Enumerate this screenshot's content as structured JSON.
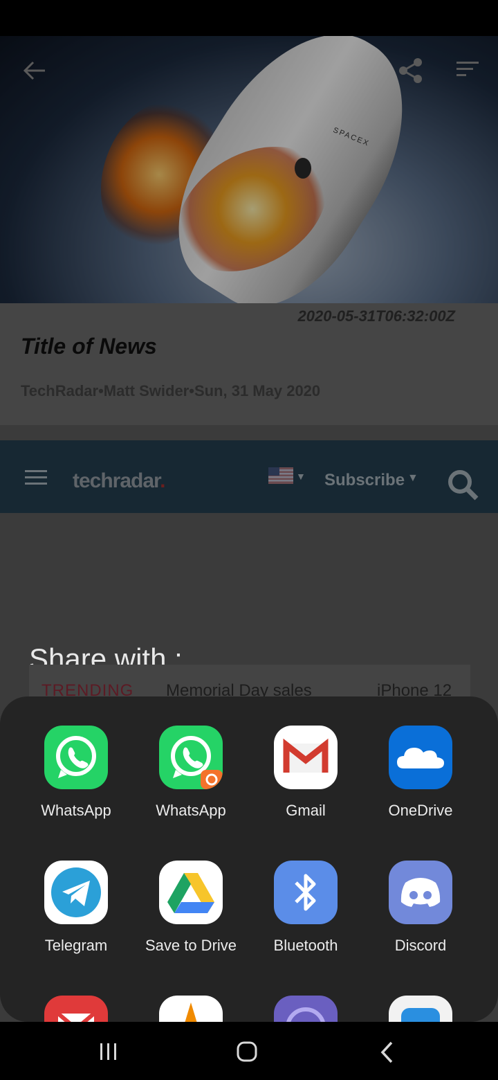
{
  "article": {
    "date": "2020-05-31T06:32:00Z",
    "title": "Title of News",
    "meta": "TechRadar•Matt Swider•Sun, 31 May 2020",
    "image_brand_text": "SPACEX"
  },
  "website": {
    "logo": "techradar",
    "subscribe": "Subscribe",
    "trending_label": "TRENDING",
    "trending_items": [
      "Memorial Day sales",
      "iPhone 12"
    ]
  },
  "share": {
    "heading": "Share with :",
    "apps": [
      {
        "label": "WhatsApp",
        "icon": "whatsapp-icon",
        "color": "#25d366"
      },
      {
        "label": "WhatsApp",
        "icon": "whatsapp-business-clone-icon",
        "color": "#25d366"
      },
      {
        "label": "Gmail",
        "icon": "gmail-icon",
        "color": "#ffffff"
      },
      {
        "label": "OneDrive",
        "icon": "onedrive-icon",
        "color": "#0a6fd8"
      },
      {
        "label": "Telegram",
        "icon": "telegram-icon",
        "color": "#ffffff"
      },
      {
        "label": "Save to Drive",
        "icon": "google-drive-icon",
        "color": "#ffffff"
      },
      {
        "label": "Bluetooth",
        "icon": "bluetooth-icon",
        "color": "#5b8de8"
      },
      {
        "label": "Discord",
        "icon": "discord-icon",
        "color": "#7289da"
      }
    ]
  },
  "colors": {
    "sheet_background": "#242424",
    "site_header": "#172833"
  }
}
